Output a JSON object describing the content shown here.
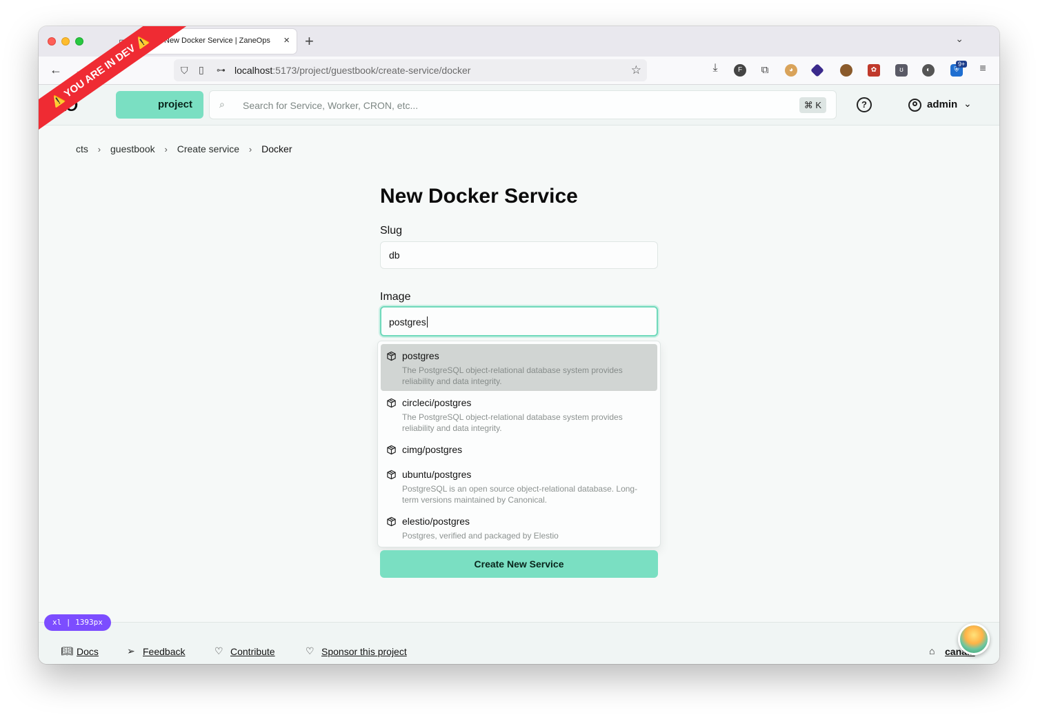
{
  "browser": {
    "tab_title": "New Docker Service | ZaneOps",
    "url_host": "localhost",
    "url_path": ":5173/project/guestbook/create-service/docker",
    "notification_badge": "9+"
  },
  "app_header": {
    "logo": "ZO",
    "new_project_label": "project",
    "search_placeholder": "Search for Service, Worker, CRON, etc...",
    "search_shortcut": "⌘ K",
    "user_name": "admin"
  },
  "dev_ribbon": "⚠️ YOU ARE IN DEV ⚠️",
  "breadcrumb": {
    "items": [
      "cts",
      "guestbook",
      "Create service",
      "Docker"
    ]
  },
  "form": {
    "title": "New Docker Service",
    "slug_label": "Slug",
    "slug_value": "db",
    "image_label": "Image",
    "image_value": "postgres",
    "submit_label": "Create New Service"
  },
  "suggestions": [
    {
      "name": "postgres",
      "description": "The PostgreSQL object-relational database system provides reliability and data integrity."
    },
    {
      "name": "circleci/postgres",
      "description": "The PostgreSQL object-relational database system provides reliability and data integrity."
    },
    {
      "name": "cimg/postgres",
      "description": ""
    },
    {
      "name": "ubuntu/postgres",
      "description": "PostgreSQL is an open source object-relational database. Long-term versions maintained by Canonical."
    },
    {
      "name": "elestio/postgres",
      "description": "Postgres, verified and packaged by Elestio"
    }
  ],
  "breakpoint_badge": "xl | 1393px",
  "footer": {
    "docs": "Docs",
    "feedback": "Feedback",
    "contribute": "Contribute",
    "sponsor": "Sponsor this project",
    "version": "cana..."
  },
  "colors": {
    "accent": "#7adfc2",
    "ribbon": "#ef2b33",
    "badge": "#7c4dff"
  }
}
